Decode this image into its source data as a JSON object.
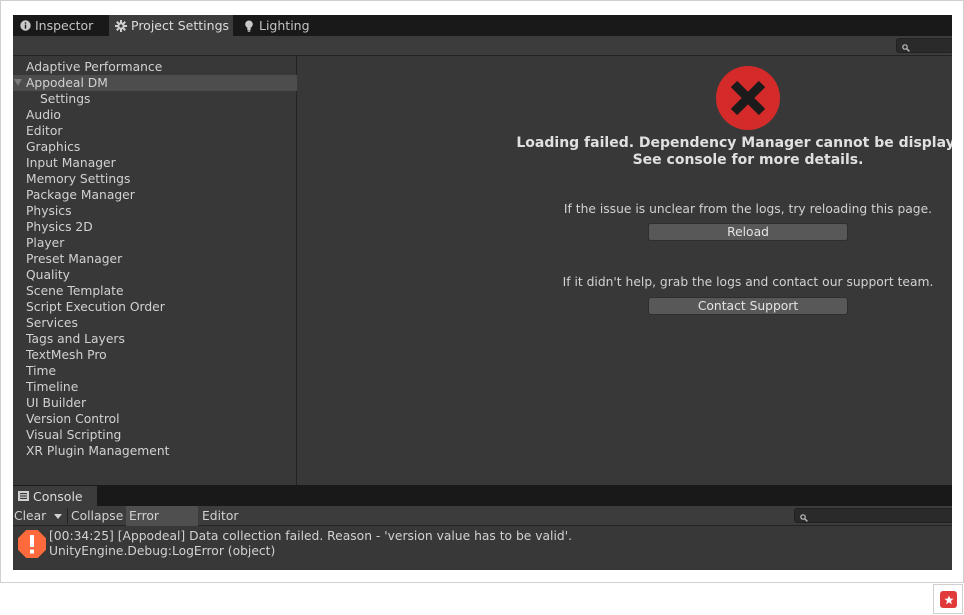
{
  "tabs": [
    {
      "label": "Inspector",
      "icon": "info-icon"
    },
    {
      "label": "Project Settings",
      "icon": "gear-icon"
    },
    {
      "label": "Lighting",
      "icon": "lightbulb-icon"
    }
  ],
  "sidebar": {
    "items": [
      {
        "label": "Adaptive Performance"
      },
      {
        "label": "Appodeal DM",
        "selected": true,
        "expanded": true
      },
      {
        "label": "Settings",
        "child": true
      },
      {
        "label": "Audio"
      },
      {
        "label": "Editor"
      },
      {
        "label": "Graphics"
      },
      {
        "label": "Input Manager"
      },
      {
        "label": "Memory Settings"
      },
      {
        "label": "Package Manager"
      },
      {
        "label": "Physics"
      },
      {
        "label": "Physics 2D"
      },
      {
        "label": "Player"
      },
      {
        "label": "Preset Manager"
      },
      {
        "label": "Quality"
      },
      {
        "label": "Scene Template"
      },
      {
        "label": "Script Execution Order"
      },
      {
        "label": "Services"
      },
      {
        "label": "Tags and Layers"
      },
      {
        "label": "TextMesh Pro"
      },
      {
        "label": "Time"
      },
      {
        "label": "Timeline"
      },
      {
        "label": "UI Builder"
      },
      {
        "label": "Version Control"
      },
      {
        "label": "Visual Scripting"
      },
      {
        "label": "XR Plugin Management"
      }
    ]
  },
  "main": {
    "error_line1": "Loading failed. Dependency Manager cannot be displayed.",
    "error_line2": "See console for more details.",
    "reload_hint": "If the issue is unclear from the logs, try reloading this page.",
    "reload_label": "Reload",
    "support_hint": "If it didn't help, grab the logs and contact our support team.",
    "support_label": "Contact Support",
    "error_color": "#d42a2a"
  },
  "console": {
    "tab_label": "Console",
    "clear_label": "Clear",
    "collapse_label": "Collapse",
    "error_pause_label": "Error Pause",
    "editor_label": "Editor",
    "log_line1": "[00:34:25] [Appodeal] Data collection failed. Reason - 'version value has to be valid'.",
    "log_line2": "UnityEngine.Debug:LogError (object)",
    "log_color": "#ff6a3d"
  },
  "badge_color": "#e03a3a"
}
